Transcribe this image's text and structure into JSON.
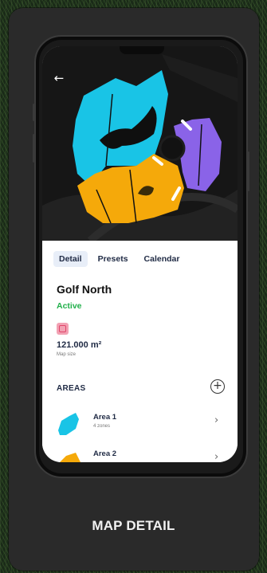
{
  "caption": "MAP DETAIL",
  "nav": {
    "back_icon": "arrow-left-icon"
  },
  "tabs": [
    {
      "label": "Detail",
      "active": true
    },
    {
      "label": "Presets",
      "active": false
    },
    {
      "label": "Calendar",
      "active": false
    }
  ],
  "map": {
    "name": "Golf North",
    "status": "Active",
    "status_color": "#22b04b",
    "size_value": "121.000 m²",
    "size_label": "Map size",
    "size_icon": "map-size-icon"
  },
  "areas": {
    "heading": "AREAS",
    "add_icon": "plus-circle-icon",
    "items": [
      {
        "name": "Area 1",
        "sub": "4 zones",
        "color": "#19c4e6"
      },
      {
        "name": "Area 2",
        "sub": "",
        "color": "#f5a90a"
      }
    ]
  },
  "colors": {
    "cyan": "#19c4e6",
    "orange": "#f5a90a",
    "purple": "#8a63e8"
  }
}
